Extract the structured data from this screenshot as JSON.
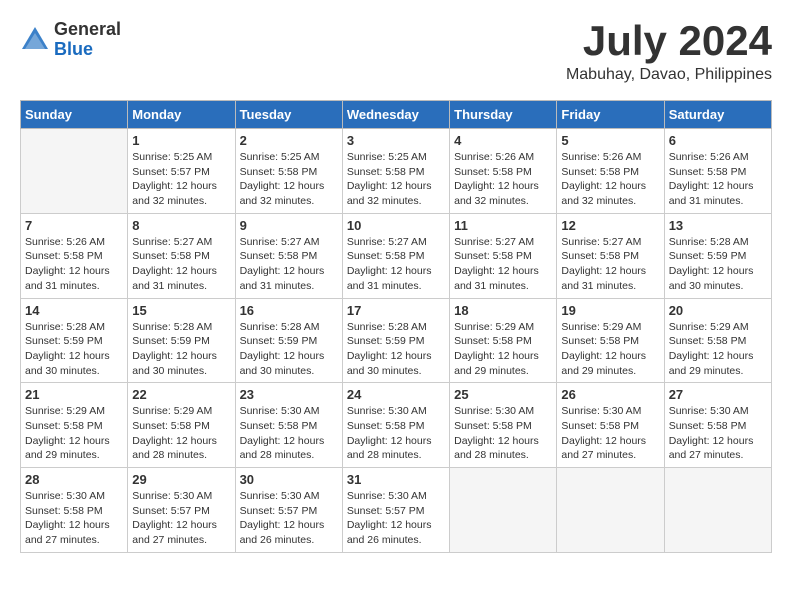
{
  "logo": {
    "general": "General",
    "blue": "Blue"
  },
  "title": {
    "month_year": "July 2024",
    "location": "Mabuhay, Davao, Philippines"
  },
  "weekdays": [
    "Sunday",
    "Monday",
    "Tuesday",
    "Wednesday",
    "Thursday",
    "Friday",
    "Saturday"
  ],
  "weeks": [
    [
      {
        "day": "",
        "empty": true
      },
      {
        "day": "1",
        "sunrise": "Sunrise: 5:25 AM",
        "sunset": "Sunset: 5:57 PM",
        "daylight": "Daylight: 12 hours and 32 minutes."
      },
      {
        "day": "2",
        "sunrise": "Sunrise: 5:25 AM",
        "sunset": "Sunset: 5:58 PM",
        "daylight": "Daylight: 12 hours and 32 minutes."
      },
      {
        "day": "3",
        "sunrise": "Sunrise: 5:25 AM",
        "sunset": "Sunset: 5:58 PM",
        "daylight": "Daylight: 12 hours and 32 minutes."
      },
      {
        "day": "4",
        "sunrise": "Sunrise: 5:26 AM",
        "sunset": "Sunset: 5:58 PM",
        "daylight": "Daylight: 12 hours and 32 minutes."
      },
      {
        "day": "5",
        "sunrise": "Sunrise: 5:26 AM",
        "sunset": "Sunset: 5:58 PM",
        "daylight": "Daylight: 12 hours and 32 minutes."
      },
      {
        "day": "6",
        "sunrise": "Sunrise: 5:26 AM",
        "sunset": "Sunset: 5:58 PM",
        "daylight": "Daylight: 12 hours and 31 minutes."
      }
    ],
    [
      {
        "day": "7",
        "sunrise": "Sunrise: 5:26 AM",
        "sunset": "Sunset: 5:58 PM",
        "daylight": "Daylight: 12 hours and 31 minutes."
      },
      {
        "day": "8",
        "sunrise": "Sunrise: 5:27 AM",
        "sunset": "Sunset: 5:58 PM",
        "daylight": "Daylight: 12 hours and 31 minutes."
      },
      {
        "day": "9",
        "sunrise": "Sunrise: 5:27 AM",
        "sunset": "Sunset: 5:58 PM",
        "daylight": "Daylight: 12 hours and 31 minutes."
      },
      {
        "day": "10",
        "sunrise": "Sunrise: 5:27 AM",
        "sunset": "Sunset: 5:58 PM",
        "daylight": "Daylight: 12 hours and 31 minutes."
      },
      {
        "day": "11",
        "sunrise": "Sunrise: 5:27 AM",
        "sunset": "Sunset: 5:58 PM",
        "daylight": "Daylight: 12 hours and 31 minutes."
      },
      {
        "day": "12",
        "sunrise": "Sunrise: 5:27 AM",
        "sunset": "Sunset: 5:58 PM",
        "daylight": "Daylight: 12 hours and 31 minutes."
      },
      {
        "day": "13",
        "sunrise": "Sunrise: 5:28 AM",
        "sunset": "Sunset: 5:59 PM",
        "daylight": "Daylight: 12 hours and 30 minutes."
      }
    ],
    [
      {
        "day": "14",
        "sunrise": "Sunrise: 5:28 AM",
        "sunset": "Sunset: 5:59 PM",
        "daylight": "Daylight: 12 hours and 30 minutes."
      },
      {
        "day": "15",
        "sunrise": "Sunrise: 5:28 AM",
        "sunset": "Sunset: 5:59 PM",
        "daylight": "Daylight: 12 hours and 30 minutes."
      },
      {
        "day": "16",
        "sunrise": "Sunrise: 5:28 AM",
        "sunset": "Sunset: 5:59 PM",
        "daylight": "Daylight: 12 hours and 30 minutes."
      },
      {
        "day": "17",
        "sunrise": "Sunrise: 5:28 AM",
        "sunset": "Sunset: 5:59 PM",
        "daylight": "Daylight: 12 hours and 30 minutes."
      },
      {
        "day": "18",
        "sunrise": "Sunrise: 5:29 AM",
        "sunset": "Sunset: 5:58 PM",
        "daylight": "Daylight: 12 hours and 29 minutes."
      },
      {
        "day": "19",
        "sunrise": "Sunrise: 5:29 AM",
        "sunset": "Sunset: 5:58 PM",
        "daylight": "Daylight: 12 hours and 29 minutes."
      },
      {
        "day": "20",
        "sunrise": "Sunrise: 5:29 AM",
        "sunset": "Sunset: 5:58 PM",
        "daylight": "Daylight: 12 hours and 29 minutes."
      }
    ],
    [
      {
        "day": "21",
        "sunrise": "Sunrise: 5:29 AM",
        "sunset": "Sunset: 5:58 PM",
        "daylight": "Daylight: 12 hours and 29 minutes."
      },
      {
        "day": "22",
        "sunrise": "Sunrise: 5:29 AM",
        "sunset": "Sunset: 5:58 PM",
        "daylight": "Daylight: 12 hours and 28 minutes."
      },
      {
        "day": "23",
        "sunrise": "Sunrise: 5:30 AM",
        "sunset": "Sunset: 5:58 PM",
        "daylight": "Daylight: 12 hours and 28 minutes."
      },
      {
        "day": "24",
        "sunrise": "Sunrise: 5:30 AM",
        "sunset": "Sunset: 5:58 PM",
        "daylight": "Daylight: 12 hours and 28 minutes."
      },
      {
        "day": "25",
        "sunrise": "Sunrise: 5:30 AM",
        "sunset": "Sunset: 5:58 PM",
        "daylight": "Daylight: 12 hours and 28 minutes."
      },
      {
        "day": "26",
        "sunrise": "Sunrise: 5:30 AM",
        "sunset": "Sunset: 5:58 PM",
        "daylight": "Daylight: 12 hours and 27 minutes."
      },
      {
        "day": "27",
        "sunrise": "Sunrise: 5:30 AM",
        "sunset": "Sunset: 5:58 PM",
        "daylight": "Daylight: 12 hours and 27 minutes."
      }
    ],
    [
      {
        "day": "28",
        "sunrise": "Sunrise: 5:30 AM",
        "sunset": "Sunset: 5:58 PM",
        "daylight": "Daylight: 12 hours and 27 minutes."
      },
      {
        "day": "29",
        "sunrise": "Sunrise: 5:30 AM",
        "sunset": "Sunset: 5:57 PM",
        "daylight": "Daylight: 12 hours and 27 minutes."
      },
      {
        "day": "30",
        "sunrise": "Sunrise: 5:30 AM",
        "sunset": "Sunset: 5:57 PM",
        "daylight": "Daylight: 12 hours and 26 minutes."
      },
      {
        "day": "31",
        "sunrise": "Sunrise: 5:30 AM",
        "sunset": "Sunset: 5:57 PM",
        "daylight": "Daylight: 12 hours and 26 minutes."
      },
      {
        "day": "",
        "empty": true
      },
      {
        "day": "",
        "empty": true
      },
      {
        "day": "",
        "empty": true
      }
    ]
  ]
}
